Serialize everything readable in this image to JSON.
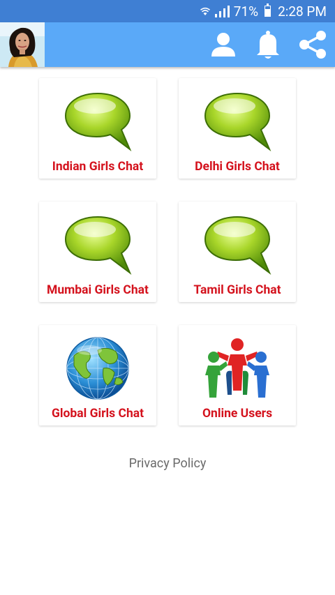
{
  "status_bar": {
    "battery_percent": "71%",
    "time": "2:28 PM",
    "battery_level": 0.71
  },
  "app_bar": {
    "icons": [
      "profile-icon",
      "bell-icon",
      "share-icon"
    ],
    "color": "#5aa9f8"
  },
  "menu": {
    "items": [
      {
        "label": "Indian Girls Chat",
        "icon": "chat-bubble-icon"
      },
      {
        "label": "Delhi Girls Chat",
        "icon": "chat-bubble-icon"
      },
      {
        "label": "Mumbai Girls Chat",
        "icon": "chat-bubble-icon"
      },
      {
        "label": "Tamil Girls Chat",
        "icon": "chat-bubble-icon"
      },
      {
        "label": "Global Girls Chat",
        "icon": "globe-icon"
      },
      {
        "label": "Online Users",
        "icon": "people-icon"
      }
    ],
    "label_color": "#d4121d"
  },
  "footer": {
    "privacy_label": "Privacy Policy"
  }
}
